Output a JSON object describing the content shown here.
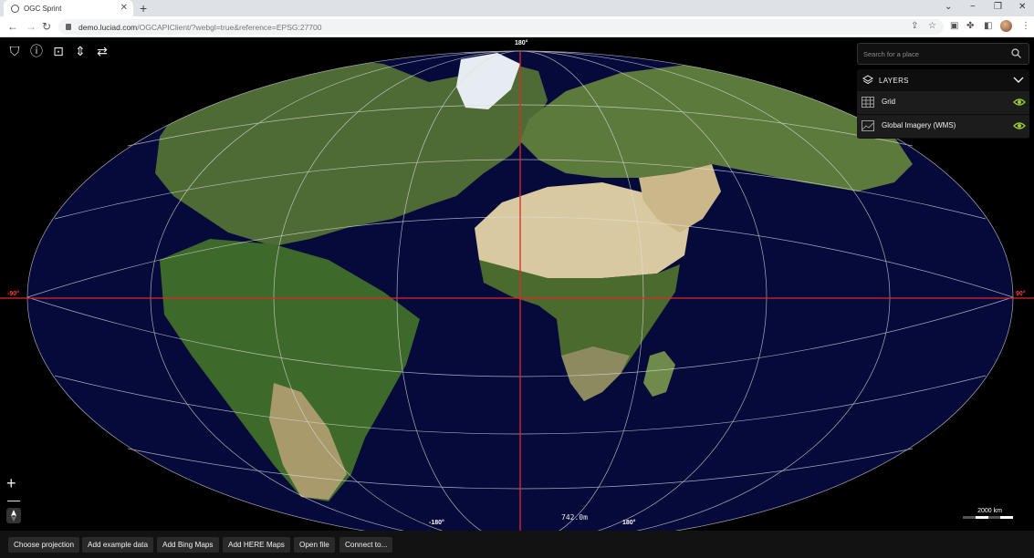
{
  "browser": {
    "tab_title": "OGC Sprint",
    "url_host": "demo.luciad.com",
    "url_path": "/OGCAPIClient/?webgl=true&reference=EPSG:27700"
  },
  "map": {
    "longitude_labels": [
      "-90°",
      "90°",
      "180°",
      "180°",
      "-180°",
      "-180°"
    ],
    "scale_label": "2000 km",
    "coordinate_readout": "742.0m",
    "grid_color": "#e0e0e0",
    "meridian_color": "#e0262b",
    "ocean_color": "#050a3a"
  },
  "search": {
    "placeholder": "Search for a place"
  },
  "layers_panel": {
    "title": "LAYERS",
    "items": [
      {
        "label": "Grid",
        "icon": "grid-icon",
        "visible": true
      },
      {
        "label": "Global Imagery (WMS)",
        "icon": "image-icon",
        "visible": true
      }
    ],
    "eye_color": "#9acd32"
  },
  "bottom_toolbar": {
    "buttons": [
      "Choose projection",
      "Add example data",
      "Add Bing Maps",
      "Add HERE Maps",
      "Open file",
      "Connect to..."
    ]
  }
}
